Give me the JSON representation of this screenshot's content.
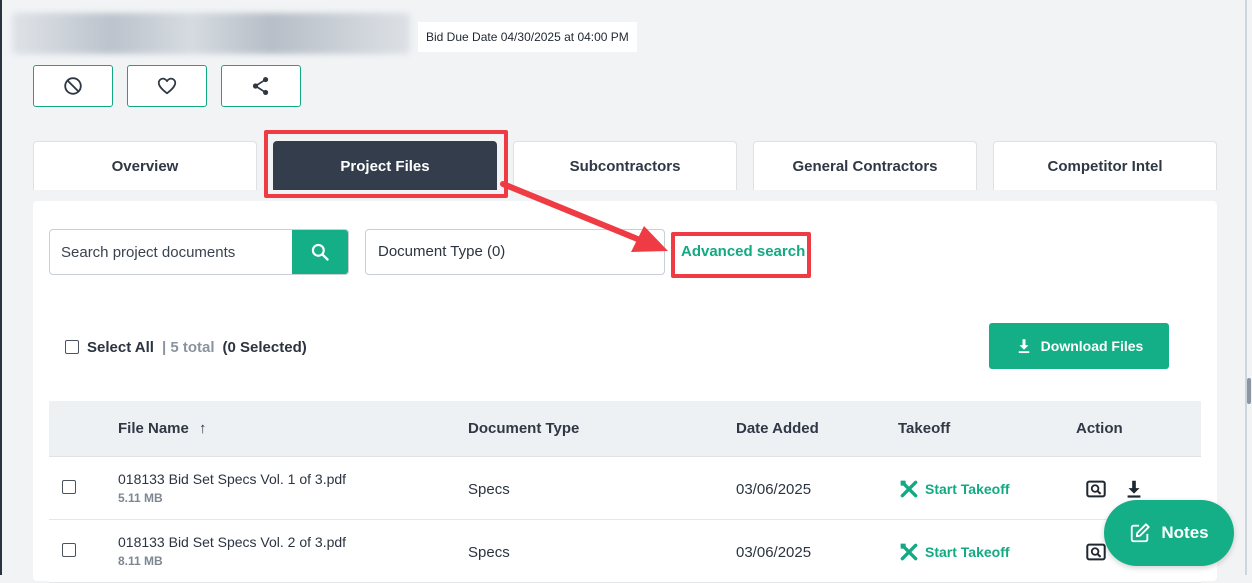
{
  "header": {
    "bid_due": "Bid Due Date 04/30/2025 at 04:00 PM"
  },
  "actions": [
    {
      "icon": "block-icon"
    },
    {
      "icon": "heart-icon"
    },
    {
      "icon": "share-icon"
    }
  ],
  "tabs": [
    {
      "label": "Overview",
      "active": false
    },
    {
      "label": "Project Files",
      "active": true
    },
    {
      "label": "Subcontractors",
      "active": false
    },
    {
      "label": "General Contractors",
      "active": false
    },
    {
      "label": "Competitor Intel",
      "active": false
    }
  ],
  "search": {
    "placeholder": "Search project documents",
    "document_type": "Document Type (0)",
    "advanced": "Advanced search"
  },
  "selection": {
    "select_all": "Select All",
    "total": "| 5 total",
    "selected": "(0 Selected)"
  },
  "download": {
    "label": "Download Files"
  },
  "table": {
    "headers": {
      "file_name": "File Name",
      "sort_indicator": "↑",
      "document_type": "Document Type",
      "date_added": "Date Added",
      "takeoff": "Takeoff",
      "action": "Action"
    },
    "rows": [
      {
        "file_name": "018133 Bid Set Specs Vol. 1 of 3.pdf",
        "size": "5.11 MB",
        "document_type": "Specs",
        "date_added": "03/06/2025",
        "takeoff": "Start Takeoff"
      },
      {
        "file_name": "018133 Bid Set Specs Vol. 2 of 3.pdf",
        "size": "8.11 MB",
        "document_type": "Specs",
        "date_added": "03/06/2025",
        "takeoff": "Start Takeoff"
      }
    ]
  },
  "notes": {
    "label": "Notes"
  },
  "colors": {
    "accent": "#14ae87",
    "active_tab": "#343d4c",
    "annotation": "#ef3b43"
  }
}
